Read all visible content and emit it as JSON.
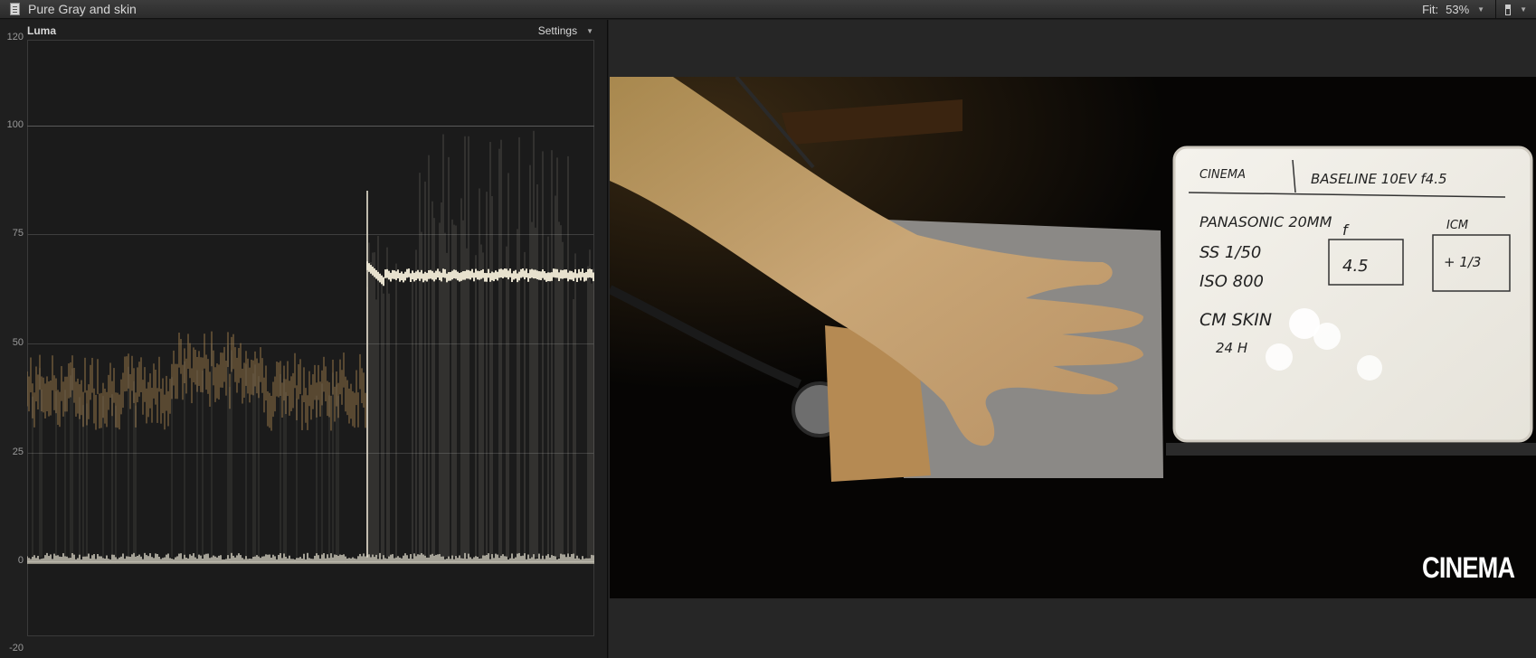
{
  "window": {
    "title": "Pure Gray and skin"
  },
  "viewer_toolbar": {
    "fit_label": "Fit:",
    "fit_value": "53%"
  },
  "scope": {
    "label": "Luma",
    "settings_label": "Settings",
    "axis_ticks": [
      {
        "value": 120,
        "label": "120"
      },
      {
        "value": 100,
        "label": "100"
      },
      {
        "value": 75,
        "label": "75"
      },
      {
        "value": 50,
        "label": "50"
      },
      {
        "value": 25,
        "label": "25"
      },
      {
        "value": 0,
        "label": "0"
      },
      {
        "value": -20,
        "label": "-20"
      }
    ],
    "y_range": [
      -20,
      120
    ],
    "colors": {
      "trace": "#e8e2d2",
      "skin_trace": "#b08a52"
    }
  },
  "viewer": {
    "watermark": "CINEMA",
    "whiteboard": {
      "header_left": "CINEMA",
      "header_right": "BASELINE 10EV f4.5",
      "line1": "PANASONIC 20MM",
      "line2": "SS 1/50",
      "line3": "ISO 800",
      "line4": "CM SKIN",
      "line5": "24 H",
      "col_f": "f",
      "col_icm": "ICM",
      "box_f": "4.5",
      "box_icm": "+ 1/3"
    }
  }
}
